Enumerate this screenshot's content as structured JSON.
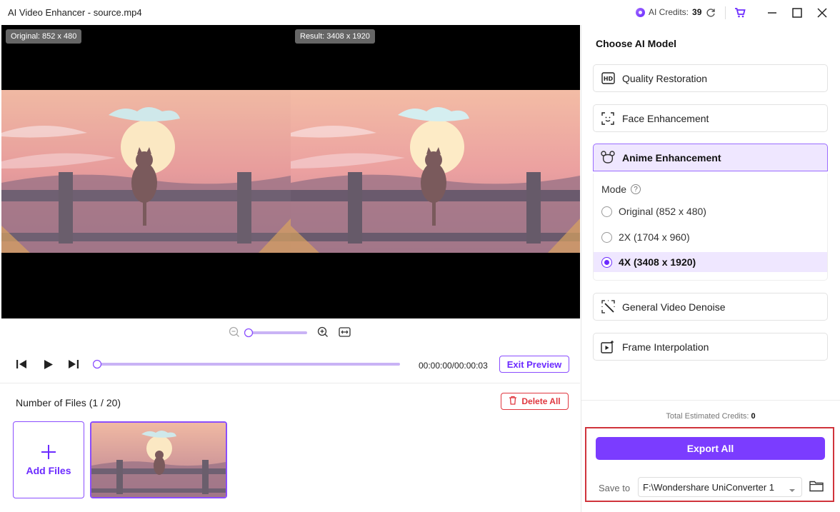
{
  "window": {
    "title": "AI Video Enhancer - source.mp4"
  },
  "credits": {
    "label": "AI Credits:",
    "value": "39"
  },
  "preview": {
    "original_tag": "Original: 852 x 480",
    "result_tag": "Result: 3408 x 1920"
  },
  "player": {
    "time": "00:00:00/00:00:03",
    "exit_preview": "Exit Preview",
    "zoom_level": 0,
    "progress": 0
  },
  "files": {
    "count_label": "Number of Files (1 / 20)",
    "delete_all": "Delete All",
    "add_files": "Add Files"
  },
  "panel": {
    "title": "Choose AI Model",
    "models": [
      {
        "label": "Quality Restoration",
        "icon": "hd-icon"
      },
      {
        "label": "Face Enhancement",
        "icon": "face-scan-icon"
      },
      {
        "label": "Anime Enhancement",
        "icon": "anime-bear-icon",
        "active": true
      },
      {
        "label": "General Video Denoise",
        "icon": "denoise-wand-icon"
      },
      {
        "label": "Frame Interpolation",
        "icon": "frame-play-icon"
      }
    ],
    "mode": {
      "label": "Mode",
      "options": [
        {
          "label": "Original (852 x 480)"
        },
        {
          "label": "2X (1704 x 960)"
        },
        {
          "label": "4X (3408 x 1920)",
          "selected": true
        }
      ]
    },
    "total_label": "Total Estimated Credits:",
    "total_value": "0",
    "export_all": "Export All",
    "save_to_label": "Save to",
    "save_path": "F:\\Wondershare UniConverter 1"
  },
  "colors": {
    "accent": "#7b3cff",
    "danger": "#e0373f"
  }
}
